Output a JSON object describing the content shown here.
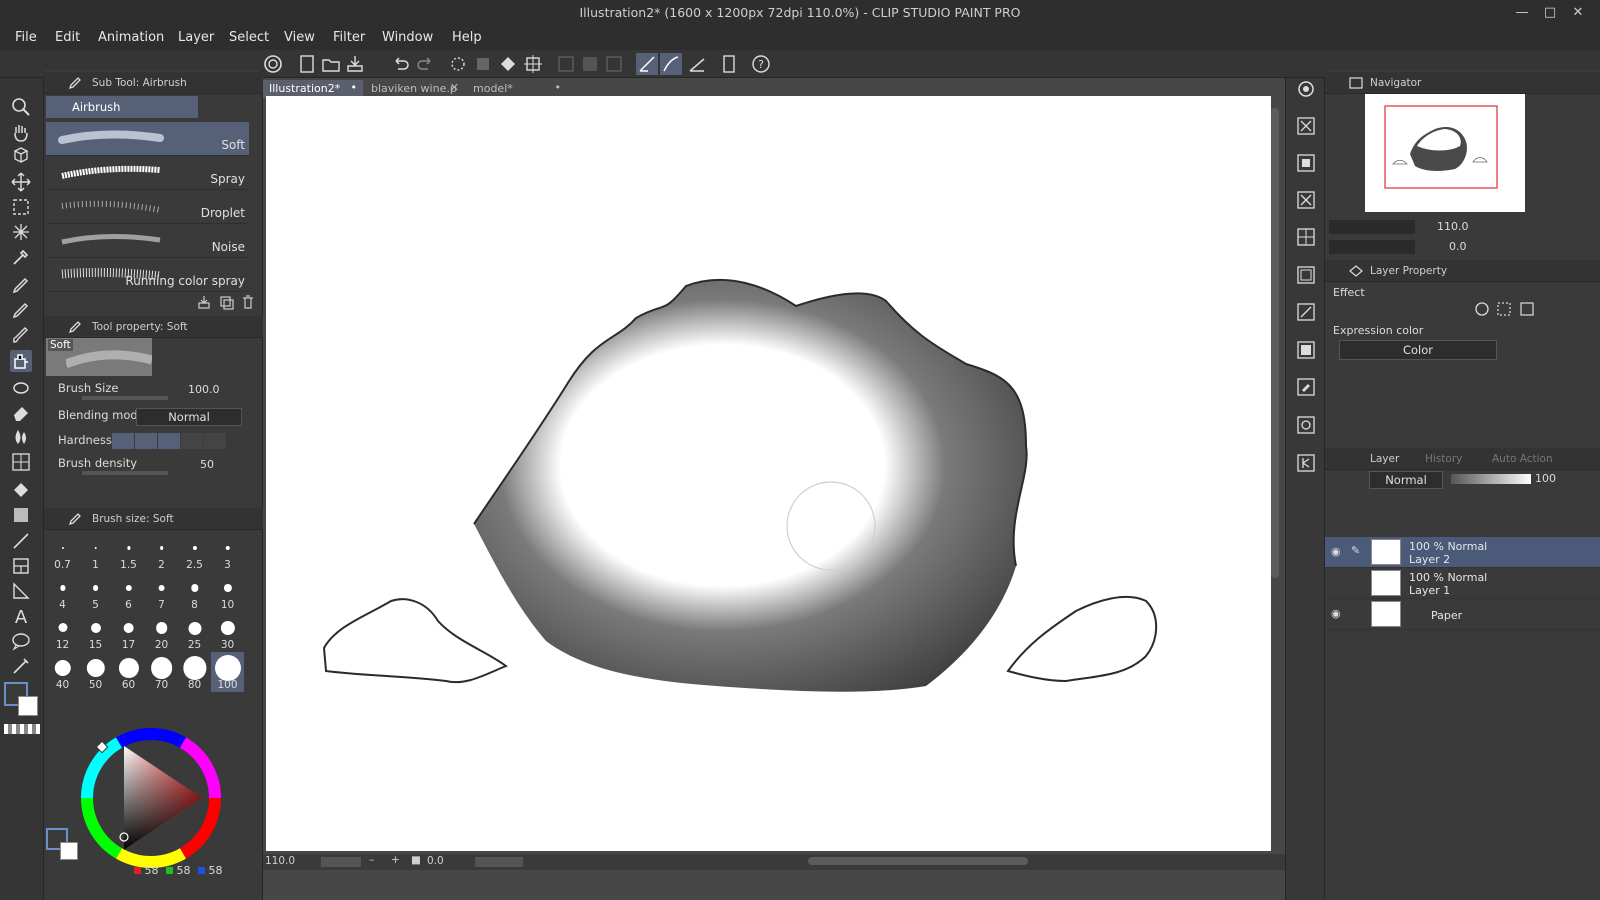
{
  "window": {
    "title": "Illustration2* (1600 x 1200px 72dpi 110.0%) - CLIP STUDIO PAINT PRO"
  },
  "menu": [
    "File",
    "Edit",
    "Animation",
    "Layer",
    "Select",
    "View",
    "Filter",
    "Window",
    "Help"
  ],
  "subtool": {
    "header": "Sub Tool: Airbrush",
    "group": "Airbrush",
    "brushes": [
      "Soft",
      "Spray",
      "Droplet",
      "Noise",
      "Running color spray"
    ],
    "selected": "Soft"
  },
  "toolprop": {
    "header": "Tool property: Soft",
    "preview_label": "Soft",
    "brush_size_label": "Brush Size",
    "brush_size_value": "100.0",
    "blend_label": "Blending mode",
    "blend_value": "Normal",
    "hardness_label": "Hardness",
    "density_label": "Brush density",
    "density_value": "50"
  },
  "brushsize": {
    "header": "Brush size: Soft",
    "sizes": [
      "0.7",
      "1",
      "1.5",
      "2",
      "2.5",
      "3",
      "4",
      "5",
      "6",
      "7",
      "8",
      "10",
      "12",
      "15",
      "17",
      "20",
      "25",
      "30",
      "40",
      "50",
      "60",
      "70",
      "80",
      "100"
    ],
    "selected": "100"
  },
  "color": {
    "r": "58",
    "g": "58",
    "b": "58"
  },
  "tabs": [
    {
      "label": "Illustration2*",
      "active": true
    },
    {
      "label": "blaviken wine.p",
      "active": false
    },
    {
      "label": "model*",
      "active": false
    }
  ],
  "status": {
    "zoom": "110.0",
    "rotation": "0.0"
  },
  "navigator": {
    "header": "Navigator",
    "zoom": "110.0",
    "rotation": "0.0"
  },
  "layerprop": {
    "header": "Layer Property",
    "effect_label": "Effect",
    "expression_label": "Expression color",
    "expression_value": "Color"
  },
  "layerpanel": {
    "tabs": [
      "Layer",
      "History",
      "Auto Action"
    ],
    "blend_mode": "Normal",
    "opacity": "100",
    "layers": [
      {
        "mode": "100 % Normal",
        "name": "Layer 2",
        "selected": true,
        "visible": true
      },
      {
        "mode": "100 % Normal",
        "name": "Layer 1",
        "selected": false,
        "visible": false
      },
      {
        "mode": "",
        "name": "Paper",
        "selected": false,
        "visible": true
      }
    ]
  },
  "colors": {
    "accent": "#566178",
    "panel": "#3a3a3a",
    "canvas_bg": "#474747"
  }
}
